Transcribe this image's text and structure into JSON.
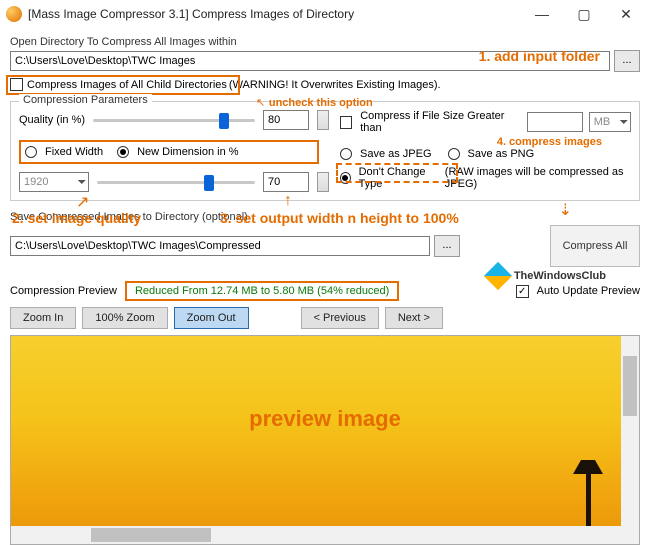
{
  "window": {
    "title": "[Mass Image Compressor 3.1] Compress Images of Directory",
    "min": "—",
    "max": "▢",
    "close": "✕"
  },
  "openDir": {
    "label": "Open Directory To Compress All Images within",
    "path": "C:\\Users\\Love\\Desktop\\TWC Images",
    "browse": "..."
  },
  "childDirs": {
    "label": "Compress Images of All Child Directories",
    "warning": "(WARNING! It Overwrites Existing Images)."
  },
  "params": {
    "legend": "Compression Parameters",
    "qualityLabel": "Quality (in %)",
    "qualityVal": "80",
    "fixedWidth": "Fixed Width",
    "newDimPct": "New Dimension in %",
    "widthVal": "1920",
    "dimVal": "70"
  },
  "right": {
    "compressIf": "Compress if File Size Greater than",
    "sizeVal": "",
    "unit": "MB",
    "saveJpeg": "Save as JPEG",
    "savePng": "Save as PNG",
    "dontChange": "Don't Change Type",
    "rawNote": "(RAW images will be compressed as JPEG)"
  },
  "save": {
    "label": "Save Compressed Images to Directory (optional)",
    "path": "C:\\Users\\Love\\Desktop\\TWC Images\\Compressed",
    "browse": "..."
  },
  "compressAll": "Compress All",
  "preview": {
    "label": "Compression Preview",
    "status": "Reduced From 12.74 MB to 5.80 MB (54% reduced)",
    "autoUpdate": "Auto Update Preview",
    "zoomIn": "Zoom In",
    "zoom100": "100% Zoom",
    "zoomOut": "Zoom Out",
    "prev": "< Previous",
    "next": "Next >"
  },
  "annot": {
    "a1": "1. add input folder",
    "a2": "uncheck this option",
    "a3": "2. set image quality",
    "a4": "3. set output width n height to 100%",
    "a5": "4. compress images",
    "a6": "preview image"
  },
  "watermark": "TheWindowsClub"
}
